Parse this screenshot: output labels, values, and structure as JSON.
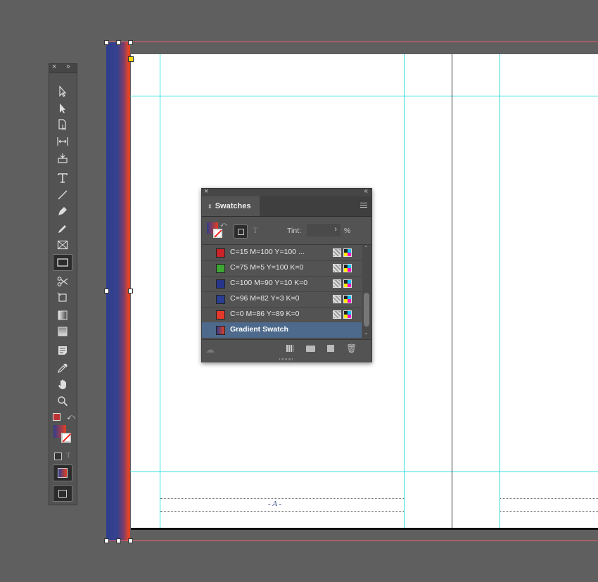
{
  "swatches_panel": {
    "tab_label": "Swatches",
    "tint_label": "Tint:",
    "tint_value": "",
    "percent_sign": "%",
    "rows": [
      {
        "name": "C=15 M=100 Y=100 ...",
        "color": "#cc2229"
      },
      {
        "name": "C=75 M=5 Y=100 K=0",
        "color": "#3fa535"
      },
      {
        "name": "C=100 M=90 Y=10 K=0",
        "color": "#26348a"
      },
      {
        "name": "C=96 M=82 Y=3 K=0",
        "color": "#2a3f92"
      },
      {
        "name": "C=0 M=86 Y=89 K=0",
        "color": "#e4382b"
      },
      {
        "name": "Gradient Swatch",
        "color": "gradient"
      }
    ]
  },
  "page": {
    "page_marker": "- A -"
  },
  "toolbox": {
    "tools": [
      "selection-tool",
      "direct-selection-tool",
      "page-tool",
      "gap-tool",
      "content-collector-tool",
      "type-tool",
      "line-tool",
      "pen-tool",
      "pencil-tool",
      "rectangle-frame-tool",
      "rectangle-tool",
      "scissors-tool",
      "free-transform-tool",
      "gradient-swatch-tool",
      "gradient-feather-tool",
      "note-tool",
      "eyedropper-tool",
      "hand-tool",
      "zoom-tool"
    ],
    "active_tool": "rectangle-tool"
  },
  "colors": {
    "gradient_start": "#2f3d8e",
    "gradient_end": "#e23e22",
    "guide": "#33dddd",
    "bleed": "#e8606a",
    "selection": "#4d6a8c"
  }
}
